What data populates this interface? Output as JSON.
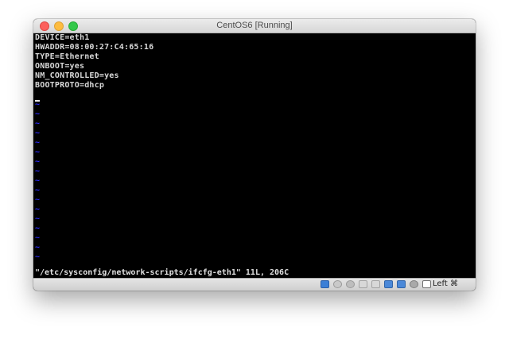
{
  "window": {
    "title": "CentOS6 [Running]"
  },
  "terminal": {
    "lines": [
      "DEVICE=eth1",
      "HWADDR=08:00:27:C4:65:16",
      "TYPE=Ethernet",
      "ONBOOT=yes",
      "NM_CONTROLLED=yes",
      "BOOTPROTO=dhcp"
    ],
    "empty_line_marker": "~",
    "status": "\"/etc/sysconfig/network-scripts/ifcfg-eth1\" 11L, 206C"
  },
  "statusbar": {
    "icons": [
      "hard-disk-icon",
      "optical-drive-icon",
      "audio-icon",
      "network-icon",
      "usb-icon",
      "shared-folder-icon",
      "display-icon",
      "video-capture-icon",
      "mouse-integration-icon",
      "keyboard-capture-icon"
    ],
    "host_key": "Left ⌘"
  },
  "colors": {
    "terminal_bg": "#000000",
    "terminal_fg": "#d8d8d8",
    "tilde": "#2a2aff"
  }
}
